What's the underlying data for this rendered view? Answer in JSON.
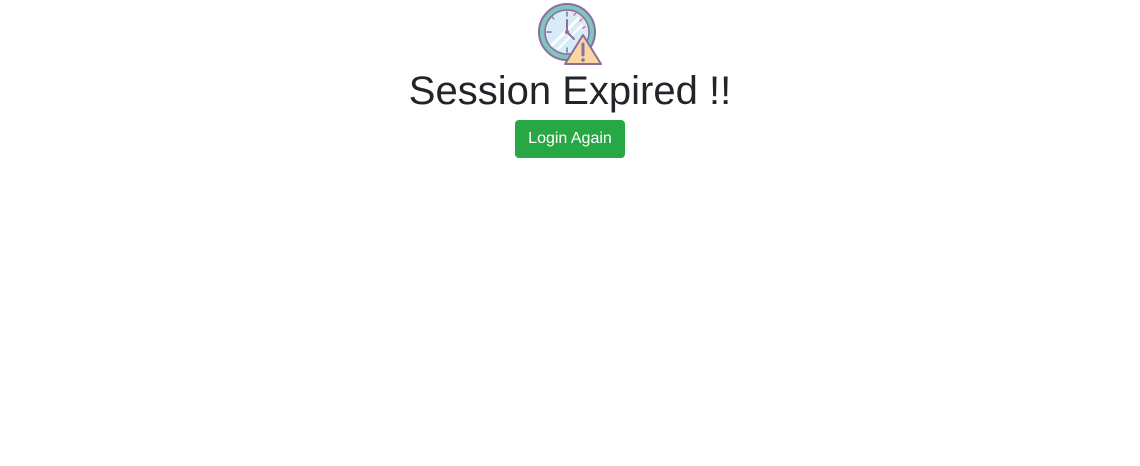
{
  "page": {
    "title": "Session Expired !!",
    "login_button_label": "Login Again"
  },
  "icons": {
    "status_icon": "clock-warning-icon"
  },
  "colors": {
    "button_background": "#28a745",
    "button_text": "#ffffff",
    "title_text": "#212529",
    "page_background": "#ffffff"
  }
}
